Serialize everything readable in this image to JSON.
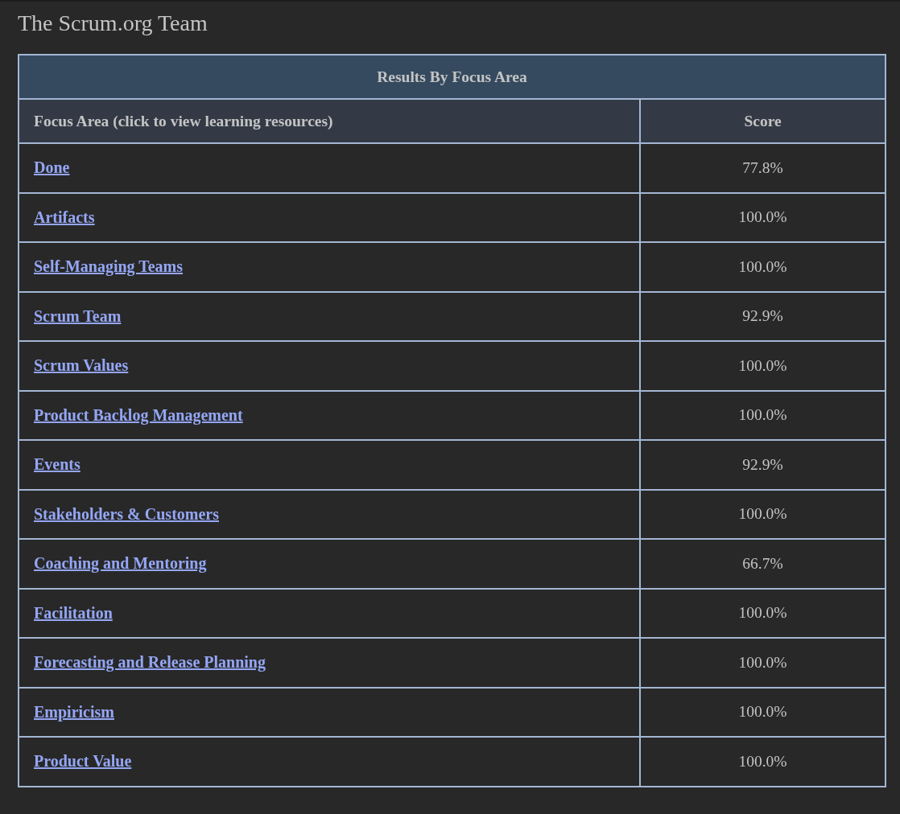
{
  "page_title": "The Scrum.org Team",
  "table": {
    "caption": "Results By Focus Area",
    "columns": [
      "Focus Area (click to view learning resources)",
      "Score"
    ],
    "rows": [
      {
        "focus_area": "Done",
        "score": "77.8%"
      },
      {
        "focus_area": "Artifacts",
        "score": "100.0%"
      },
      {
        "focus_area": "Self-Managing Teams",
        "score": "100.0%"
      },
      {
        "focus_area": "Scrum Team",
        "score": "92.9%"
      },
      {
        "focus_area": "Scrum Values",
        "score": "100.0%"
      },
      {
        "focus_area": "Product Backlog Management",
        "score": "100.0%"
      },
      {
        "focus_area": "Events",
        "score": "92.9%"
      },
      {
        "focus_area": "Stakeholders & Customers",
        "score": "100.0%"
      },
      {
        "focus_area": "Coaching and Mentoring",
        "score": "66.7%"
      },
      {
        "focus_area": "Facilitation",
        "score": "100.0%"
      },
      {
        "focus_area": "Forecasting and Release Planning",
        "score": "100.0%"
      },
      {
        "focus_area": "Empiricism",
        "score": "100.0%"
      },
      {
        "focus_area": "Product Value",
        "score": "100.0%"
      }
    ]
  }
}
